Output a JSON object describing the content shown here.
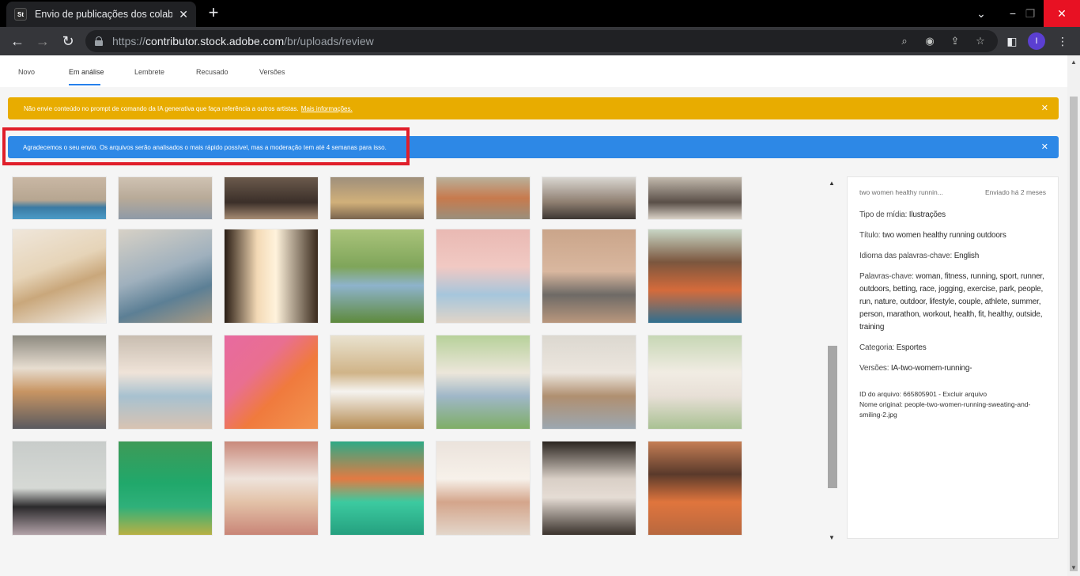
{
  "browser": {
    "tab_title": "Envio de publicações dos colabor",
    "favicon_text": "St",
    "url_prefix": "https://",
    "url_host": "contributor.stock.adobe.com",
    "url_path": "/br/uploads/review",
    "avatar_letter": "I"
  },
  "nav": {
    "tabs": [
      "Novo",
      "Em análise",
      "Lembrete",
      "Recusado",
      "Versões"
    ],
    "active_index": 1
  },
  "banners": {
    "yellow_text": "Não envie conteúdo no prompt de comando da IA generativa que faça referência a outros artistas.",
    "yellow_link": "Mais informações.",
    "blue_text": "Agradecemos o seu envio. Os arquivos serão analisados o mais rápido possível, mas a moderação tem até 4 semanas para isso."
  },
  "panel": {
    "title": "two women healthy runnin...",
    "sent": "Enviado há 2 meses",
    "media_type_label": "Tipo de mídia:",
    "media_type_value": "Ilustrações",
    "title_label": "Título:",
    "title_value": "two women healthy running outdoors",
    "keywords_lang_label": "Idioma das palavras-chave:",
    "keywords_lang_value": "English",
    "keywords_label": "Palavras-chave:",
    "keywords_value": "woman, fitness, running, sport, runner, outdoors, betting, race, jogging, exercise, park, people, run, nature, outdoor, lifestyle, couple, athlete, summer, person, marathon, workout, health, fit, healthy, outside, training",
    "category_label": "Categoria:",
    "category_value": "Esportes",
    "versions_label": "Versões:",
    "versions_value": "IA-two-womem-running-",
    "file_id": "ID do arquivo: 665805901 - Excluir arquivo",
    "original_name": "Nome original: people-two-women-running-sweating-and-smiling-2.jpg"
  },
  "colors": {
    "accent": "#2680eb",
    "warning": "#e8ac00",
    "info": "#2d88e6",
    "highlight": "#e01e2a"
  }
}
